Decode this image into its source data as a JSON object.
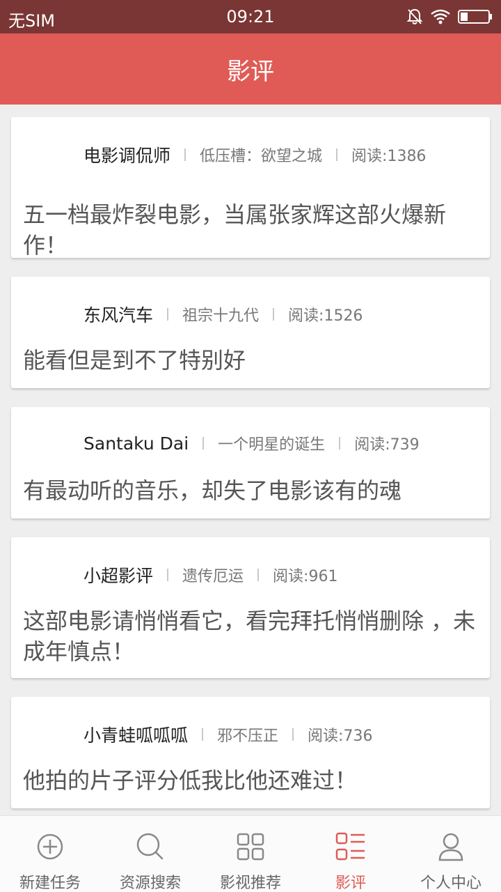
{
  "status_bar": {
    "carrier": "无SIM",
    "time": "09:21"
  },
  "app_bar": {
    "title": "影评"
  },
  "reviews": [
    {
      "author": "电影调侃师",
      "movie": "低压槽：欲望之城",
      "reads": "阅读:1386",
      "title": "五一档最炸裂电影，当属张家辉这部火爆新作！"
    },
    {
      "author": "东风汽车",
      "movie": "祖宗十九代",
      "reads": "阅读:1526",
      "title": "能看但是到不了特别好"
    },
    {
      "author": "Santaku Dai",
      "movie": "一个明星的诞生",
      "reads": "阅读:739",
      "title": "有最动听的音乐，却失了电影该有的魂"
    },
    {
      "author": "小超影评",
      "movie": "遗传厄运",
      "reads": "阅读:961",
      "title": "这部电影请悄悄看它，看完拜托悄悄删除 ，未成年慎点！"
    },
    {
      "author": "小青蛙呱呱呱",
      "movie": "邪不压正",
      "reads": "阅读:736",
      "title": "他拍的片子评分低我比他还难过！"
    }
  ],
  "bottom_nav": [
    {
      "label": "新建任务",
      "icon": "plus-circle-icon"
    },
    {
      "label": "资源搜索",
      "icon": "search-icon"
    },
    {
      "label": "影视推荐",
      "icon": "grid-icon"
    },
    {
      "label": "影评",
      "icon": "list-icon",
      "active": true
    },
    {
      "label": "个人中心",
      "icon": "user-icon"
    }
  ],
  "colors": {
    "status_bar": "#7a3634",
    "app_bar": "#e05b56",
    "accent": "#e05b56",
    "background": "#eeeeee"
  }
}
